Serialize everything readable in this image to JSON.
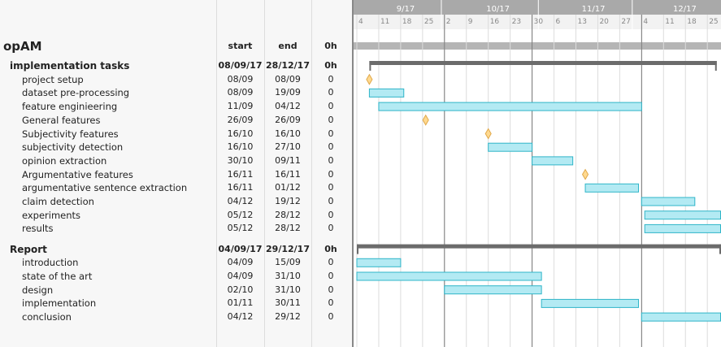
{
  "project": {
    "name": "opAM",
    "columns": {
      "start": "start",
      "end": "end",
      "hours": "0h"
    }
  },
  "groups": [
    {
      "name": "implementation tasks",
      "start": "08/09/17",
      "end": "28/12/17",
      "hours": "0h",
      "bar": {
        "from": "2017-09-08",
        "to": "2017-12-28"
      },
      "tasks": [
        {
          "name": "project setup",
          "start": "08/09",
          "end": "08/09",
          "hours": "0",
          "milestone": true,
          "from": "2017-09-08",
          "to": "2017-09-08"
        },
        {
          "name": "dataset pre-processing",
          "start": "08/09",
          "end": "19/09",
          "hours": "0",
          "milestone": false,
          "from": "2017-09-08",
          "to": "2017-09-19"
        },
        {
          "name": "feature enginieering",
          "start": "11/09",
          "end": "04/12",
          "hours": "0",
          "milestone": false,
          "from": "2017-09-11",
          "to": "2017-12-04"
        },
        {
          "name": "General  features",
          "start": "26/09",
          "end": "26/09",
          "hours": "0",
          "milestone": true,
          "from": "2017-09-26",
          "to": "2017-09-26"
        },
        {
          "name": "Subjectivity features",
          "start": "16/10",
          "end": "16/10",
          "hours": "0",
          "milestone": true,
          "from": "2017-10-16",
          "to": "2017-10-16"
        },
        {
          "name": "subjectivity detection",
          "start": "16/10",
          "end": "27/10",
          "hours": "0",
          "milestone": false,
          "from": "2017-10-16",
          "to": "2017-10-30"
        },
        {
          "name": "opinion extraction",
          "start": "30/10",
          "end": "09/11",
          "hours": "0",
          "milestone": false,
          "from": "2017-10-30",
          "to": "2017-11-12"
        },
        {
          "name": "Argumentative features",
          "start": "16/11",
          "end": "16/11",
          "hours": "0",
          "milestone": true,
          "from": "2017-11-16",
          "to": "2017-11-16"
        },
        {
          "name": "argumentative sentence extraction",
          "start": "16/11",
          "end": "01/12",
          "hours": "0",
          "milestone": false,
          "from": "2017-11-16",
          "to": "2017-12-03"
        },
        {
          "name": "claim detection",
          "start": "04/12",
          "end": "19/12",
          "hours": "0",
          "milestone": false,
          "from": "2017-12-04",
          "to": "2017-12-21"
        },
        {
          "name": "experiments",
          "start": "05/12",
          "end": "28/12",
          "hours": "0",
          "milestone": false,
          "from": "2017-12-05",
          "to": "2017-12-31"
        },
        {
          "name": "results",
          "start": "05/12",
          "end": "28/12",
          "hours": "0",
          "milestone": false,
          "from": "2017-12-05",
          "to": "2017-12-31"
        }
      ]
    },
    {
      "name": "Report",
      "start": "04/09/17",
      "end": "29/12/17",
      "hours": "0h",
      "bar": {
        "from": "2017-09-04",
        "to": "2017-12-31"
      },
      "tasks": [
        {
          "name": "introduction",
          "start": "04/09",
          "end": "15/09",
          "hours": "0",
          "milestone": false,
          "from": "2017-09-04",
          "to": "2017-09-18"
        },
        {
          "name": "state of the art",
          "start": "04/09",
          "end": "31/10",
          "hours": "0",
          "milestone": false,
          "from": "2017-09-04",
          "to": "2017-11-02"
        },
        {
          "name": "design",
          "start": "02/10",
          "end": "31/10",
          "hours": "0",
          "milestone": false,
          "from": "2017-10-02",
          "to": "2017-11-02"
        },
        {
          "name": "implementation",
          "start": "01/11",
          "end": "30/11",
          "hours": "0",
          "milestone": false,
          "from": "2017-11-02",
          "to": "2017-12-03"
        },
        {
          "name": "conclusion",
          "start": "04/12",
          "end": "29/12",
          "hours": "0",
          "milestone": false,
          "from": "2017-12-04",
          "to": "2017-12-31"
        }
      ]
    }
  ],
  "timeline": {
    "months": [
      {
        "label": "9/17",
        "first": "2017-09-01"
      },
      {
        "label": "10/17",
        "first": "2017-10-01"
      },
      {
        "label": "11/17",
        "first": "2017-11-01"
      },
      {
        "label": "12/17",
        "first": "2017-12-01"
      }
    ],
    "weeks": [
      {
        "label": "4",
        "date": "2017-09-04"
      },
      {
        "label": "11",
        "date": "2017-09-11"
      },
      {
        "label": "18",
        "date": "2017-09-18"
      },
      {
        "label": "25",
        "date": "2017-09-25"
      },
      {
        "label": "2",
        "date": "2017-10-02"
      },
      {
        "label": "9",
        "date": "2017-10-09"
      },
      {
        "label": "16",
        "date": "2017-10-16"
      },
      {
        "label": "23",
        "date": "2017-10-23"
      },
      {
        "label": "30",
        "date": "2017-10-30"
      },
      {
        "label": "6",
        "date": "2017-11-06"
      },
      {
        "label": "13",
        "date": "2017-11-13"
      },
      {
        "label": "20",
        "date": "2017-11-20"
      },
      {
        "label": "27",
        "date": "2017-11-27"
      },
      {
        "label": "4",
        "date": "2017-12-04"
      },
      {
        "label": "11",
        "date": "2017-12-11"
      },
      {
        "label": "18",
        "date": "2017-12-18"
      },
      {
        "label": "25",
        "date": "2017-12-25"
      }
    ],
    "month_boundaries": [
      "2017-10-02",
      "2017-10-30",
      "2017-12-04"
    ]
  },
  "colors": {
    "task_bar_fill": "#b3eaf3",
    "task_bar_stroke": "#2fb5c8",
    "group_bar": "#6b6b6b",
    "milestone_fill": "#ffd98f",
    "milestone_stroke": "#e0a84a",
    "header_bg": "#a9a9a9"
  }
}
